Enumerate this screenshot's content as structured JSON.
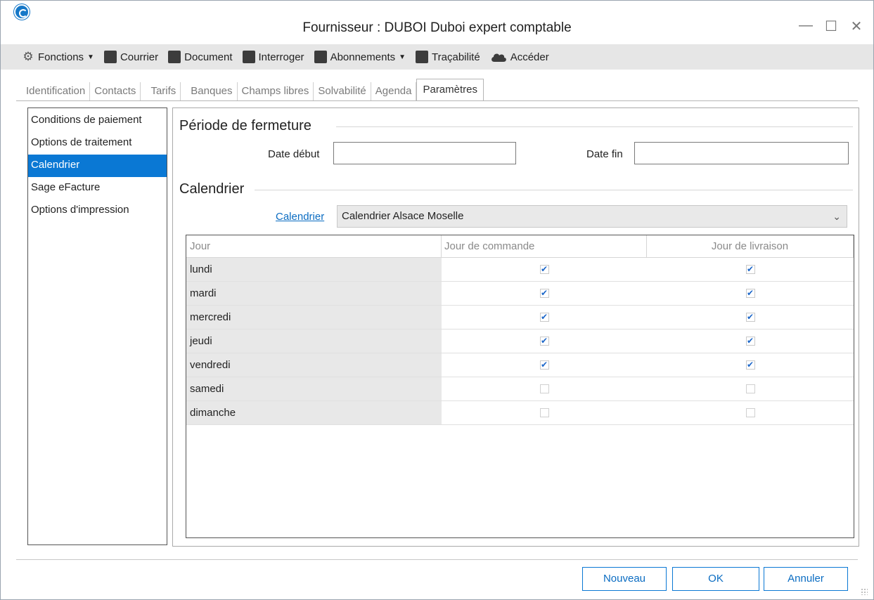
{
  "window": {
    "title": "Fournisseur : DUBOI Duboi expert comptable"
  },
  "toolbar": {
    "fonctions": "Fonctions",
    "courrier": "Courrier",
    "document": "Document",
    "interroger": "Interroger",
    "abonnements": "Abonnements",
    "tracabilite": "Traçabilité",
    "acceder": "Accéder"
  },
  "tabs": [
    "Identification",
    "Contacts",
    "Tarifs",
    "Banques",
    "Champs libres",
    "Solvabilité",
    "Agenda",
    "Paramètres"
  ],
  "active_tab": "Paramètres",
  "sidebar": {
    "items": [
      "Conditions de paiement",
      "Options de traitement",
      "Calendrier",
      "Sage eFacture",
      "Options d'impression"
    ],
    "selected": "Calendrier"
  },
  "periode": {
    "title": "Période de fermeture",
    "date_debut_label": "Date début",
    "date_debut_value": "",
    "date_fin_label": "Date fin",
    "date_fin_value": ""
  },
  "calendrier": {
    "title": "Calendrier",
    "link_label": "Calendrier",
    "selected": "Calendrier Alsace Moselle"
  },
  "grid": {
    "headers": [
      "Jour",
      "Jour de commande",
      "Jour de livraison"
    ],
    "rows": [
      {
        "jour": "lundi",
        "commande": true,
        "livraison": true
      },
      {
        "jour": "mardi",
        "commande": true,
        "livraison": true
      },
      {
        "jour": "mercredi",
        "commande": true,
        "livraison": true
      },
      {
        "jour": "jeudi",
        "commande": true,
        "livraison": true
      },
      {
        "jour": "vendredi",
        "commande": true,
        "livraison": true
      },
      {
        "jour": "samedi",
        "commande": false,
        "livraison": false
      },
      {
        "jour": "dimanche",
        "commande": false,
        "livraison": false
      }
    ]
  },
  "buttons": {
    "nouveau": "Nouveau",
    "ok": "OK",
    "annuler": "Annuler"
  },
  "colors": {
    "accent": "#0a78d4",
    "link": "#0a6cc2",
    "check": "#1b66c9"
  }
}
